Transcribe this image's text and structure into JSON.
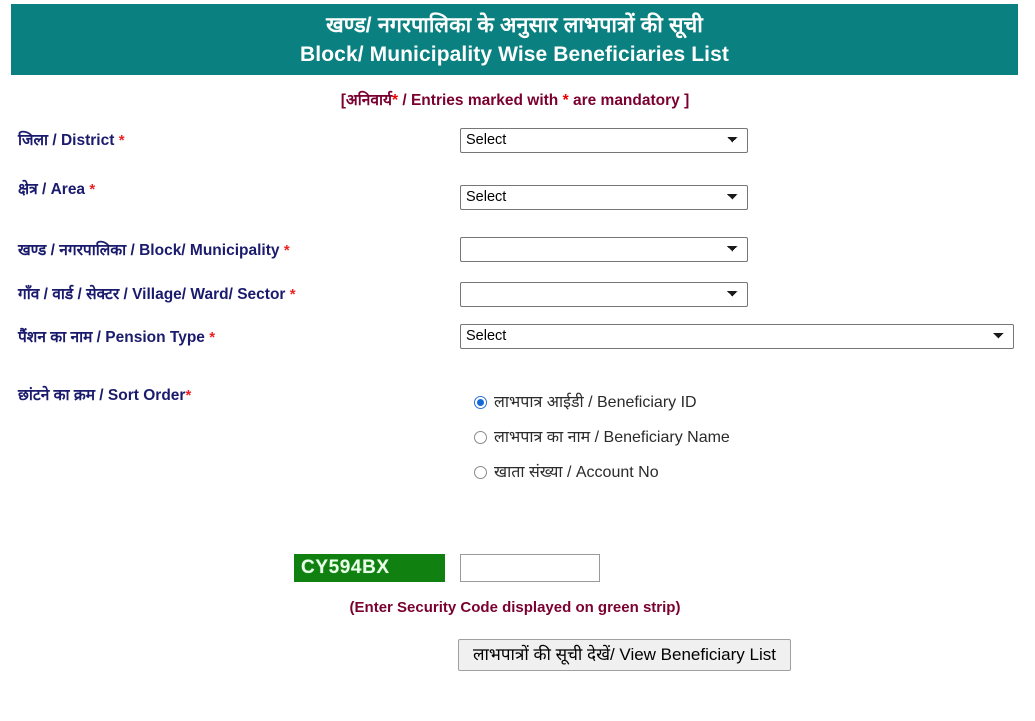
{
  "header": {
    "title_hi": "खण्ड/ नगरपालिका के अनुसार लाभपात्रों की सूची",
    "title_en": "Block/ Municipality Wise Beneficiaries List",
    "background_color": "#0a8080",
    "text_color": "#ffffff"
  },
  "mandatory_note": {
    "prefix": "[अनिवार्य",
    "star1": "*",
    "middle": "/ Entries marked with",
    "star2": "*",
    "suffix": "are mandatory ]",
    "color": "#7a0030",
    "star_color": "#ee0000"
  },
  "fields": {
    "district": {
      "label_hi": "जिला / District",
      "label_en": "District",
      "required_mark": "*",
      "selected": "Select",
      "options": [
        "Select"
      ]
    },
    "area": {
      "label_hi": "क्षेत्र / Area",
      "required_mark": "*",
      "selected": "Select",
      "options": [
        "Select"
      ]
    },
    "block": {
      "label_hi": "खण्ड / नगरपालिका / Block/ Municipality",
      "required_mark": "*",
      "selected": "",
      "options": [
        ""
      ]
    },
    "village": {
      "label_hi": "गाँव / वार्ड / सेक्टर / Village/ Ward/ Sector",
      "required_mark": "*",
      "selected": "",
      "options": [
        ""
      ]
    },
    "pension_type": {
      "label_hi": "पैंशन का नाम / Pension Type",
      "required_mark": "*",
      "selected": "Select",
      "options": [
        "Select"
      ]
    },
    "sort_order": {
      "label_hi": "छांटने का क्रम / Sort Order",
      "required_mark": "*",
      "options": [
        {
          "label": "लाभपात्र आईडी / Beneficiary ID",
          "checked": true
        },
        {
          "label": "लाभपात्र का नाम / Beneficiary Name",
          "checked": false
        },
        {
          "label": "खाता संख्या / Account No",
          "checked": false
        }
      ]
    }
  },
  "captcha": {
    "code": "CY594BX",
    "strip_color": "#108010",
    "strip_text_color": "#e8ffe8",
    "input_value": "",
    "input_placeholder": "",
    "note": "(Enter Security Code displayed on green strip)",
    "note_color": "#7a0030"
  },
  "submit": {
    "label": "लाभपात्रों की सूची देखें/ View Beneficiary List"
  },
  "label_color": "#1b1b6e",
  "required_color": "#ee2222"
}
